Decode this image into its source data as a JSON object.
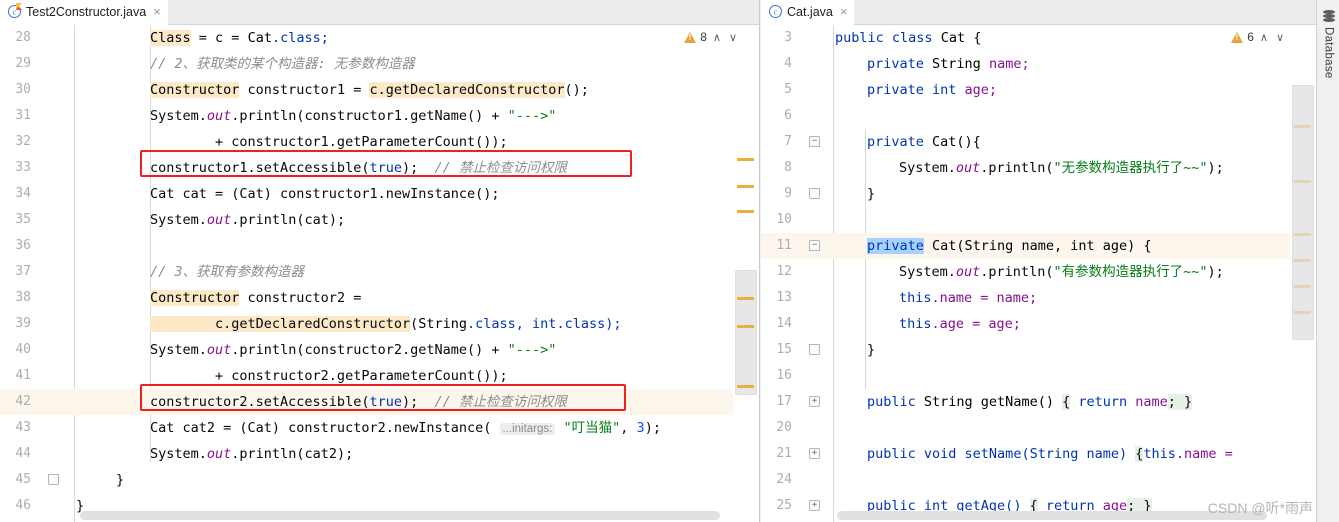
{
  "window": {
    "tool_window_right": {
      "label": "Database",
      "icon": "database-icon"
    }
  },
  "watermark": "CSDN @听*雨声",
  "left_pane": {
    "tab": {
      "title": "Test2Constructor.java",
      "icon": "java-class-file-icon",
      "close": "×"
    },
    "inspections": {
      "count": "8",
      "prev": "∧",
      "next": "∨"
    },
    "lines": [
      {
        "n": "28"
      },
      {
        "n": "29"
      },
      {
        "n": "30"
      },
      {
        "n": "31"
      },
      {
        "n": "32"
      },
      {
        "n": "33"
      },
      {
        "n": "34"
      },
      {
        "n": "35"
      },
      {
        "n": "36"
      },
      {
        "n": "37"
      },
      {
        "n": "38"
      },
      {
        "n": "39"
      },
      {
        "n": "40"
      },
      {
        "n": "41"
      },
      {
        "n": "42"
      },
      {
        "n": "43"
      },
      {
        "n": "44"
      },
      {
        "n": "45"
      },
      {
        "n": "46"
      }
    ],
    "code": {
      "l28": "Class c = Cat.class;",
      "l29": "// 2、获取类的某个构造器: 无参数构造器",
      "l30": "Constructor constructor1 = c.getDeclaredConstructor();",
      "l31": "System.out.println(constructor1.getName() + \"--->\"",
      "l32": "        + constructor1.getParameterCount());",
      "l33": "constructor1.setAccessible(true); // 禁止检查访问权限",
      "l34": "Cat cat = (Cat) constructor1.newInstance();",
      "l35": "System.out.println(cat);",
      "l37": "// 3、获取有参数构造器",
      "l38": "Constructor constructor2 =",
      "l39": "        c.getDeclaredConstructor(String.class, int.class);",
      "l40": "System.out.println(constructor2.getName() + \"--->\"",
      "l41": "        + constructor2.getParameterCount());",
      "l42": "constructor2.setAccessible(true); // 禁止检查访问权限",
      "l43": "Cat cat2 = (Cat) constructor2.newInstance( ...initargs: \"叮当猫\", 3);",
      "l44": "System.out.println(cat2);",
      "l45": "}",
      "l46": "}"
    },
    "tokens": {
      "kw_class": "Class",
      "ident_c": "c",
      "eq": " = ",
      "cat": "Cat",
      "dot_class": ".class;",
      "comment2": "// 2、获取类的某个构造器: 无参数构造器",
      "Constructor": "Constructor",
      "constructor1": " constructor1 = ",
      "getDeclCtor": "c.getDeclaredConstructor",
      "parens_semi": "();",
      "System": "System.",
      "out": "out",
      "println_c1_getName": ".println(constructor1.getName() + ",
      "arrow_str": "\"--->\"",
      "plus_getParamCount1": "        + constructor1.getParameterCount());",
      "c1_setAccessible": "constructor1.setAccessible(",
      "true_kw": "true",
      "close_semi": ");",
      "comment_forbid": "// 禁止检查访问权限",
      "cat_cast_new1": "Cat cat = (Cat) constructor1.newInstance();",
      "println_cat": ".println(cat);",
      "comment3": "// 3、获取有参数构造器",
      "constructor2_decl": " constructor2 =",
      "indent_getDeclCtor2": "        c.getDeclaredConstructor",
      "paren_open": "(",
      "String": "String",
      "dotclass_comma": ".class, ",
      "int_kw": "int",
      "dotclass_close": ".class);",
      "println_c2_getName": ".println(constructor2.getName() + ",
      "plus_getParamCount2": "        + constructor2.getParameterCount());",
      "c2_setAccessible": "constructor2.setAccessible(",
      "cat2_decl": "Cat cat2 = (Cat) constructor2.newInstance(",
      "inlay_initargs": "...initargs:",
      "str_dingdang": "\"叮当猫\"",
      "comma": ", ",
      "num3": "3",
      "close2": ");",
      "println_cat2": ".println(cat2);",
      "brace_close": "}"
    }
  },
  "right_pane": {
    "tab": {
      "title": "Cat.java",
      "icon": "java-class-file-icon",
      "close": "×"
    },
    "inspections": {
      "count": "6",
      "prev": "∧",
      "next": "∨"
    },
    "lines": [
      {
        "n": "3"
      },
      {
        "n": "4"
      },
      {
        "n": "5"
      },
      {
        "n": "6"
      },
      {
        "n": "7"
      },
      {
        "n": "8"
      },
      {
        "n": "9"
      },
      {
        "n": "10"
      },
      {
        "n": "11"
      },
      {
        "n": "12"
      },
      {
        "n": "13"
      },
      {
        "n": "14"
      },
      {
        "n": "15"
      },
      {
        "n": "16"
      },
      {
        "n": "17"
      },
      {
        "n": "20"
      },
      {
        "n": "21"
      },
      {
        "n": "24"
      },
      {
        "n": "25"
      }
    ],
    "code": {
      "l3": "public class Cat {",
      "l4": "    private String name;",
      "l5": "    private int age;",
      "l7": "    private Cat(){",
      "l8": "        System.out.println(\"无参数构造器执行了~~\");",
      "l9": "    }",
      "l11": "    private Cat(String name, int age) {",
      "l12": "        System.out.println(\"有参数构造器执行了~~\");",
      "l13": "        this.name = name;",
      "l14": "        this.age = age;",
      "l15": "    }",
      "l17": "    public String getName() { return name; }",
      "l21": "    public void setName(String name) { this.name = ",
      "l25": "    public int getAge() { return age; }"
    },
    "tokens": {
      "public": "public",
      "class_kw": " class ",
      "Cat": "Cat",
      "brace_open": " {",
      "private": "private",
      "String": " String ",
      "name_semi": "name;",
      "int_kw": " int ",
      "age_semi": "age;",
      "ctor_noarg": " Cat(){",
      "System": "System.",
      "out": "out",
      "println_open": ".println(",
      "str_noarg": "\"无参数构造器执行了~~\"",
      "close_semi": ");",
      "brace_close": "}",
      "ctor_args": " Cat(String name, int age) {",
      "str_args": "\"有参数构造器执行了~~\"",
      "this_name": "this",
      "dot_name_eq_name": ".name = name;",
      "dot_age_eq_age": ".age = age;",
      "getName_sig": " String getName() ",
      "fold_brace_open": "{",
      "return_kw": " return ",
      "name_field": "name",
      "semi": "; ",
      "fold_brace_close": "}",
      "setName_sig": " void setName(String name) ",
      "this_kw": "this",
      "dot_name_eq": ".name = ",
      "getAge_sig": " int getAge() ",
      "age_field": "age"
    }
  }
}
